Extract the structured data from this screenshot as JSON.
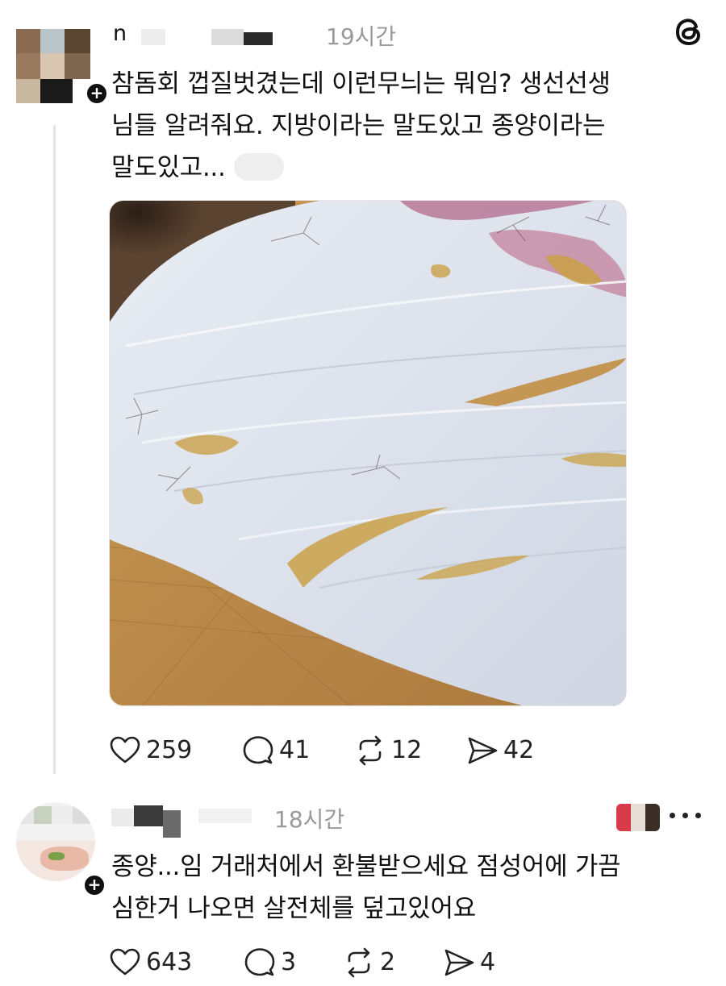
{
  "app": {
    "logo_icon": "threads-logo-icon"
  },
  "posts": [
    {
      "username": "n",
      "timestamp": "19시간",
      "text_lines": [
        "참돔회 껍질벗겼는데 이런무늬는 뭐임? 생선선생",
        "님들 알려줘요. 지방이라는 말도있고 종양이라는",
        "말도있고..."
      ],
      "image_alt": "raw red sea bream fillet with yellow-brown spots",
      "stats": {
        "likes": "259",
        "replies": "41",
        "reposts": "12",
        "shares": "42"
      }
    },
    {
      "username": "",
      "timestamp": "18시간",
      "text_lines": [
        "종양...임 거래처에서 환불받으세요 점성어에 가끔",
        "심한거 나오면 살전체를 덮고있어요"
      ],
      "stats": {
        "likes": "643",
        "replies": "3",
        "reposts": "2",
        "shares": "4"
      }
    }
  ],
  "colors": {
    "text": "#101010",
    "muted": "#9a9a9a",
    "icon": "#222222",
    "thread_line": "#e4e4e4"
  },
  "icons": {
    "like": "heart-icon",
    "reply": "speech-bubble-icon",
    "repost": "repost-arrows-icon",
    "share": "send-icon",
    "follow": "plus-icon",
    "more": "more-dots-icon"
  }
}
